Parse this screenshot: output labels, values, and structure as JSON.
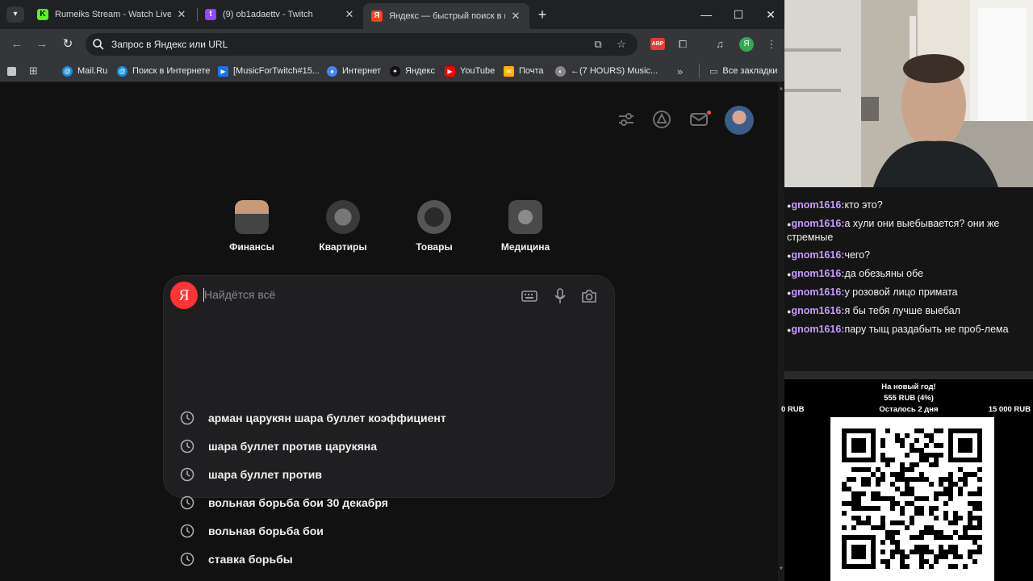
{
  "browser": {
    "tabs": [
      {
        "title": "Rumeiks Stream - Watch Live o",
        "favicon": "K",
        "favicon_color": "#53fc18",
        "active": false
      },
      {
        "title": "(9) ob1adaettv - Twitch",
        "favicon": "t",
        "favicon_color": "#9146ff",
        "active": false
      },
      {
        "title": "Яндекс — быстрый поиск в ин",
        "favicon": "Я",
        "favicon_color": "#fc3f1d",
        "active": true
      }
    ],
    "toolbar": {
      "omnibox_text": "Запрос в Яндекс или URL",
      "ext_badge": "ABP",
      "profile_letter": "Я"
    },
    "bookmarks": [
      {
        "label": "Mail.Ru",
        "icon": "@",
        "color": "#168de2"
      },
      {
        "label": "Поиск в Интернете",
        "icon": "@",
        "color": "#168de2"
      },
      {
        "label": "[MusicForTwitch#15...",
        "icon": "▶",
        "color": "#1a73e8"
      },
      {
        "label": "Интернет",
        "icon": "●",
        "color": "#4285f4"
      },
      {
        "label": "Яндекс",
        "icon": "✦",
        "color": "#111111"
      },
      {
        "label": "YouTube",
        "icon": "▶",
        "color": "#ff0000"
      },
      {
        "label": "Почта",
        "icon": "✉",
        "color": "#ffb300"
      },
      {
        "label": "←(7 HOURS) Music...",
        "icon": "◐",
        "color": "#888888"
      }
    ],
    "all_bookmarks": "Все закладки"
  },
  "yandex": {
    "services": [
      {
        "label": "Финансы",
        "icon": "finance-icon"
      },
      {
        "label": "Квартиры",
        "icon": "building-icon"
      },
      {
        "label": "Товары",
        "icon": "headphones-icon"
      },
      {
        "label": "Медицина",
        "icon": "medicine-icon"
      }
    ],
    "logo_letter": "Я",
    "search_placeholder": "Найдётся всё",
    "suggestions": [
      "арман царукян шара буллет коэффициент",
      "шара буллет против царукяна",
      "шара буллет против",
      "вольная борьба бои 30 декабря",
      "вольная борьба бои",
      "ставка борьбы"
    ]
  },
  "chat": {
    "messages": [
      {
        "user": "gnom1616:",
        "text": "кто это?"
      },
      {
        "user": "gnom1616:",
        "text": "а хули они выебывается? они же стремные"
      },
      {
        "user": "gnom1616:",
        "text": "чего?"
      },
      {
        "user": "gnom1616:",
        "text": "да обезьяны обе"
      },
      {
        "user": "gnom1616:",
        "text": "у розовой лицо примата"
      },
      {
        "user": "gnom1616:",
        "text": "я бы тебя лучше выебал"
      },
      {
        "user": "gnom1616:",
        "text": "пару тыщ раздабыть не проб-лема"
      }
    ]
  },
  "donation_goal": {
    "title": "На новый год!",
    "progress": "555 RUB (4%)",
    "progress_fraction": 0.04,
    "min": "0 RUB",
    "remaining": "Осталось 2 дня",
    "max": "15 000 RUB"
  }
}
